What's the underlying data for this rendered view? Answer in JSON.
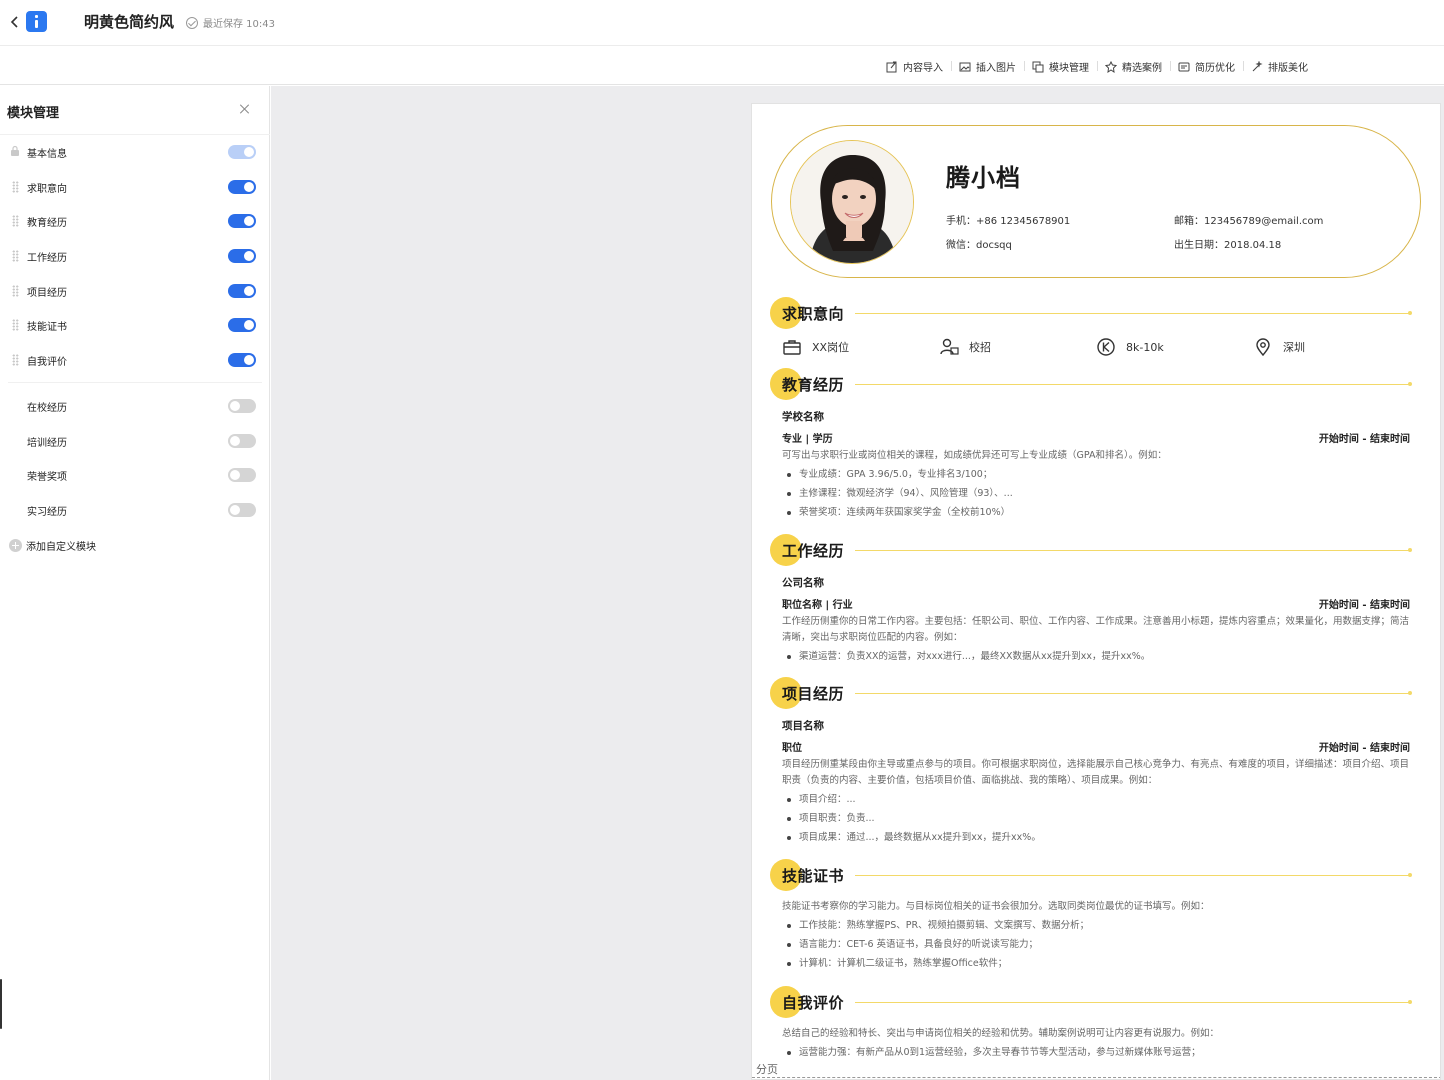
{
  "topbar": {
    "doc_title": "明黄色简约风",
    "save_status": "最近保存 10:43"
  },
  "toolbar": {
    "items": [
      {
        "label": "内容导入",
        "icon": "import-icon"
      },
      {
        "label": "插入图片",
        "icon": "image-icon"
      },
      {
        "label": "模块管理",
        "icon": "modules-icon"
      },
      {
        "label": "精选案例",
        "icon": "cases-icon"
      },
      {
        "label": "简历优化",
        "icon": "optimize-icon"
      },
      {
        "label": "排版美化",
        "icon": "beautify-icon"
      }
    ]
  },
  "module_panel": {
    "title": "模块管理",
    "enabled": [
      {
        "label": "基本信息",
        "on": true,
        "locked": true
      },
      {
        "label": "求职意向",
        "on": true
      },
      {
        "label": "教育经历",
        "on": true
      },
      {
        "label": "工作经历",
        "on": true
      },
      {
        "label": "项目经历",
        "on": true
      },
      {
        "label": "技能证书",
        "on": true
      },
      {
        "label": "自我评价",
        "on": true
      }
    ],
    "disabled": [
      {
        "label": "在校经历",
        "on": false
      },
      {
        "label": "培训经历",
        "on": false
      },
      {
        "label": "荣誉奖项",
        "on": false
      },
      {
        "label": "实习经历",
        "on": false
      }
    ],
    "add_custom": "添加自定义模块"
  },
  "colors": {
    "accent_yellow": "#f7d24a",
    "capsule_border": "#d8b54a",
    "toggle_on": "#2b6de8",
    "toggle_off": "#d5d5d5"
  },
  "resume": {
    "name": "腾小档",
    "phone": "手机：+86 12345678901",
    "email": "邮箱：123456789@email.com",
    "wechat": "微信：docsqq",
    "birth": "出生日期：2018.04.18",
    "intent": {
      "title": "求职意向",
      "position": "XX岗位",
      "type": "校招",
      "salary": "8k-10k",
      "city": "深圳"
    },
    "education": {
      "title": "教育经历",
      "school": "学校名称",
      "major": "专业 | 学历",
      "time": "开始时间 - 结束时间",
      "desc": "可写出与求职行业或岗位相关的课程，如成绩优异还可写上专业成绩（GPA和排名）。例如：",
      "bullets": [
        "专业成绩：GPA 3.96/5.0，专业排名3/100；",
        "主修课程：微观经济学（94）、风险管理（93）、...",
        "荣誉奖项：连续两年获国家奖学金（全校前10%）"
      ]
    },
    "work": {
      "title": "工作经历",
      "company": "公司名称",
      "role": "职位名称 | 行业",
      "time": "开始时间 - 结束时间",
      "desc": "工作经历侧重你的日常工作内容。主要包括：任职公司、职位、工作内容、工作成果。注意善用小标题，提炼内容重点；效果量化，用数据支撑；简洁清晰，突出与求职岗位匹配的内容。例如：",
      "bullets": [
        "渠道运营：负责XX的运营，对xxx进行...，最终XX数据从xx提升到xx，提升xx%。"
      ]
    },
    "project": {
      "title": "项目经历",
      "name": "项目名称",
      "role": "职位",
      "time": "开始时间 - 结束时间",
      "desc": "项目经历侧重某段由你主导或重点参与的项目。你可根据求职岗位，选择能展示自己核心竞争力、有亮点、有难度的项目，详细描述：项目介绍、项目职责（负责的内容、主要价值，包括项目价值、面临挑战、我的策略）、项目成果。例如：",
      "bullets": [
        "项目介绍：...",
        "项目职责：负责...",
        "项目成果：通过...，最终数据从xx提升到xx，提升xx%。"
      ]
    },
    "skills": {
      "title": "技能证书",
      "desc": "技能证书考察你的学习能力。与目标岗位相关的证书会很加分。选取同类岗位最优的证书填写。例如：",
      "bullets": [
        "工作技能：熟练掌握PS、PR、视频拍摄剪辑、文案撰写、数据分析；",
        "语言能力：CET-6 英语证书，具备良好的听说读写能力；",
        "计算机：计算机二级证书，熟练掌握Office软件；"
      ]
    },
    "self_eval": {
      "title": "自我评价",
      "desc": "总结自己的经验和特长、突出与申请岗位相关的经验和优势。辅助案例说明可让内容更有说服力。例如：",
      "bullets": [
        "运营能力强：有新产品从0到1运营经验，多次主导春节节等大型活动，参与过新媒体账号运营；"
      ]
    },
    "page_break": "分页"
  }
}
